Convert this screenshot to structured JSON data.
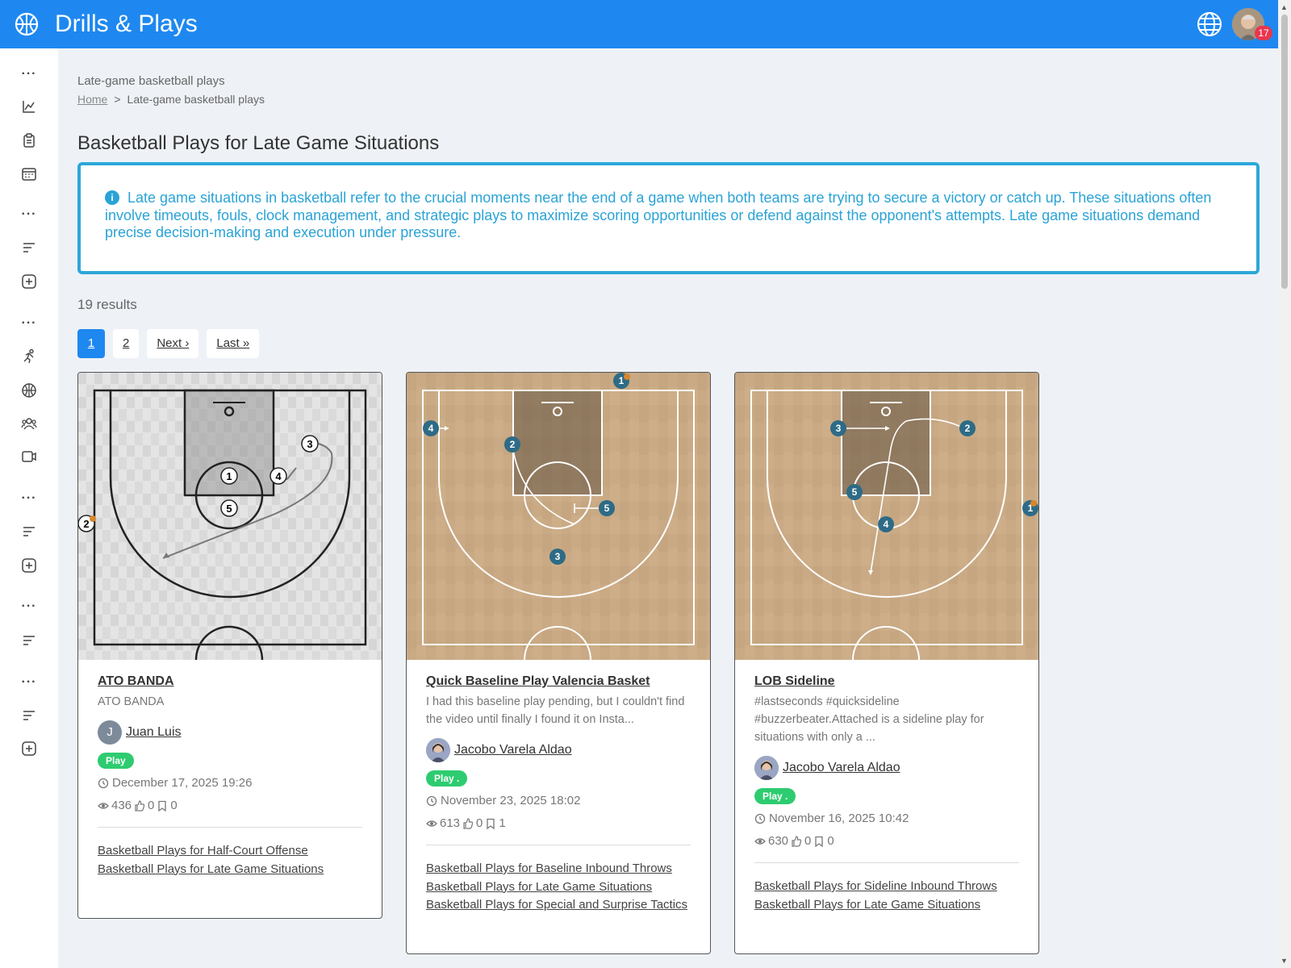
{
  "header": {
    "title": "Drills & Plays",
    "logo_icon": "basketball-icon",
    "notifications": "17"
  },
  "page": {
    "crumb_heading": "Late-game basketball plays",
    "breadcrumb_home": "Home",
    "breadcrumb_sep": ">",
    "breadcrumb_current": "Late-game basketball plays",
    "title": "Basketball Plays for Late Game Situations",
    "info": "Late game situations in basketball refer to the crucial moments near the end of a game when both teams are trying to secure a victory or catch up. These situations often involve timeouts, fouls, clock management, and strategic plays to maximize scoring opportunities or defend against the opponent's attempts. Late game situations demand precise decision-making and execution under pressure.",
    "results": "19 results"
  },
  "pagination": {
    "p1": "1",
    "p2": "2",
    "next": "Next ›",
    "last": "Last »"
  },
  "cards": [
    {
      "title": "ATO BANDA",
      "desc": "ATO  BANDA",
      "author_initial": "J",
      "author": "Juan Luis",
      "tag": "Play",
      "date": "December 17, 2025 19:26",
      "views": "436",
      "likes": "0",
      "saves": "0",
      "links": [
        "Basketball Plays for Half-Court Offense",
        "Basketball Plays for Late Game Situations"
      ]
    },
    {
      "title": "Quick Baseline Play Valencia Basket",
      "desc": "I had this baseline play pending, but I couldn't find the video until finally I found it on Insta...",
      "author": "Jacobo Varela Aldao",
      "tag": "Play .",
      "date": "November 23, 2025 18:02",
      "views": "613",
      "likes": "0",
      "saves": "1",
      "links": [
        "Basketball Plays for Baseline Inbound Throws",
        "Basketball Plays for Late Game Situations",
        "Basketball Plays for Special and Surprise Tactics"
      ]
    },
    {
      "title": "LOB Sideline",
      "desc": "#lastseconds #quicksideline #buzzerbeater.Attached is a sideline play for situations with only a ...",
      "author": "Jacobo Varela Aldao",
      "tag": "Play .",
      "date": "November 16, 2025 10:42",
      "views": "630",
      "likes": "0",
      "saves": "0",
      "links": [
        "Basketball Plays for Sideline Inbound Throws",
        "Basketball Plays for Late Game Situations"
      ]
    }
  ],
  "diagrams": {
    "card1_players": [
      "1",
      "2",
      "3",
      "4",
      "5"
    ],
    "card2_players": [
      "1",
      "2",
      "3",
      "4",
      "5"
    ],
    "card3_players": [
      "1",
      "2",
      "3",
      "4",
      "5"
    ]
  }
}
